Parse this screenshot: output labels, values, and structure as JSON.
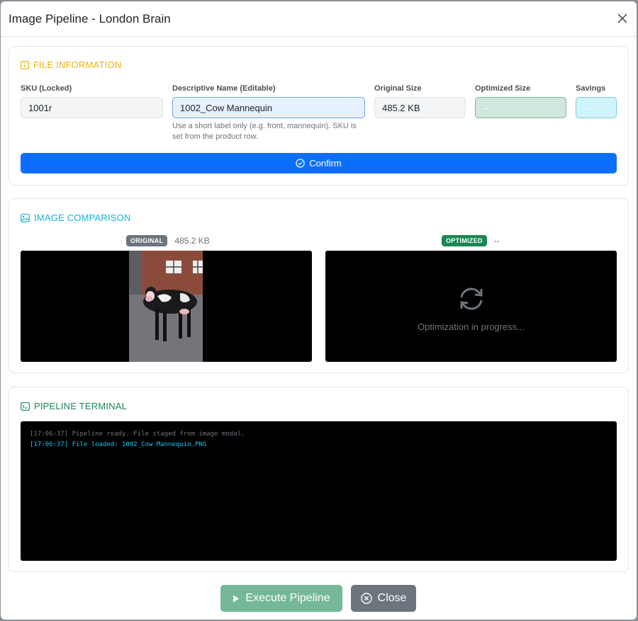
{
  "modal": {
    "title": "Image Pipeline - London Brain"
  },
  "file_info": {
    "section_title": "FILE INFORMATION",
    "sku": {
      "label": "SKU (Locked)",
      "value": "1001r"
    },
    "name": {
      "label": "Descriptive Name (Editable)",
      "value": "1002_Cow Mannequin",
      "help": "Use a short label only (e.g. front, mannequin). SKU is set from the product row."
    },
    "original_size": {
      "label": "Original Size",
      "value": "485.2 KB"
    },
    "optimized_size": {
      "label": "Optimized Size",
      "value": "--"
    },
    "savings": {
      "label": "Savings",
      "value": "--"
    },
    "confirm_label": "Confirm"
  },
  "comparison": {
    "section_title": "IMAGE COMPARISON",
    "original": {
      "badge": "ORIGINAL",
      "size": "485.2 KB"
    },
    "optimized": {
      "badge": "OPTIMIZED",
      "size": "--",
      "status": "Optimization in progress..."
    }
  },
  "terminal": {
    "section_title": "PIPELINE TERMINAL",
    "lines": [
      {
        "text": "[17:06:37] Pipeline ready. File staged from image modal.",
        "level": "dim"
      },
      {
        "text": "[17:06:37] File loaded: 1002_Cow Mannequin.PNG",
        "level": "info"
      }
    ]
  },
  "footer": {
    "execute_label": "Execute Pipeline",
    "close_label": "Close"
  },
  "colors": {
    "primary": "#0d6efd",
    "warning": "#f0b400",
    "info": "#13b4dc",
    "success": "#198754",
    "secondary": "#6c757d"
  }
}
